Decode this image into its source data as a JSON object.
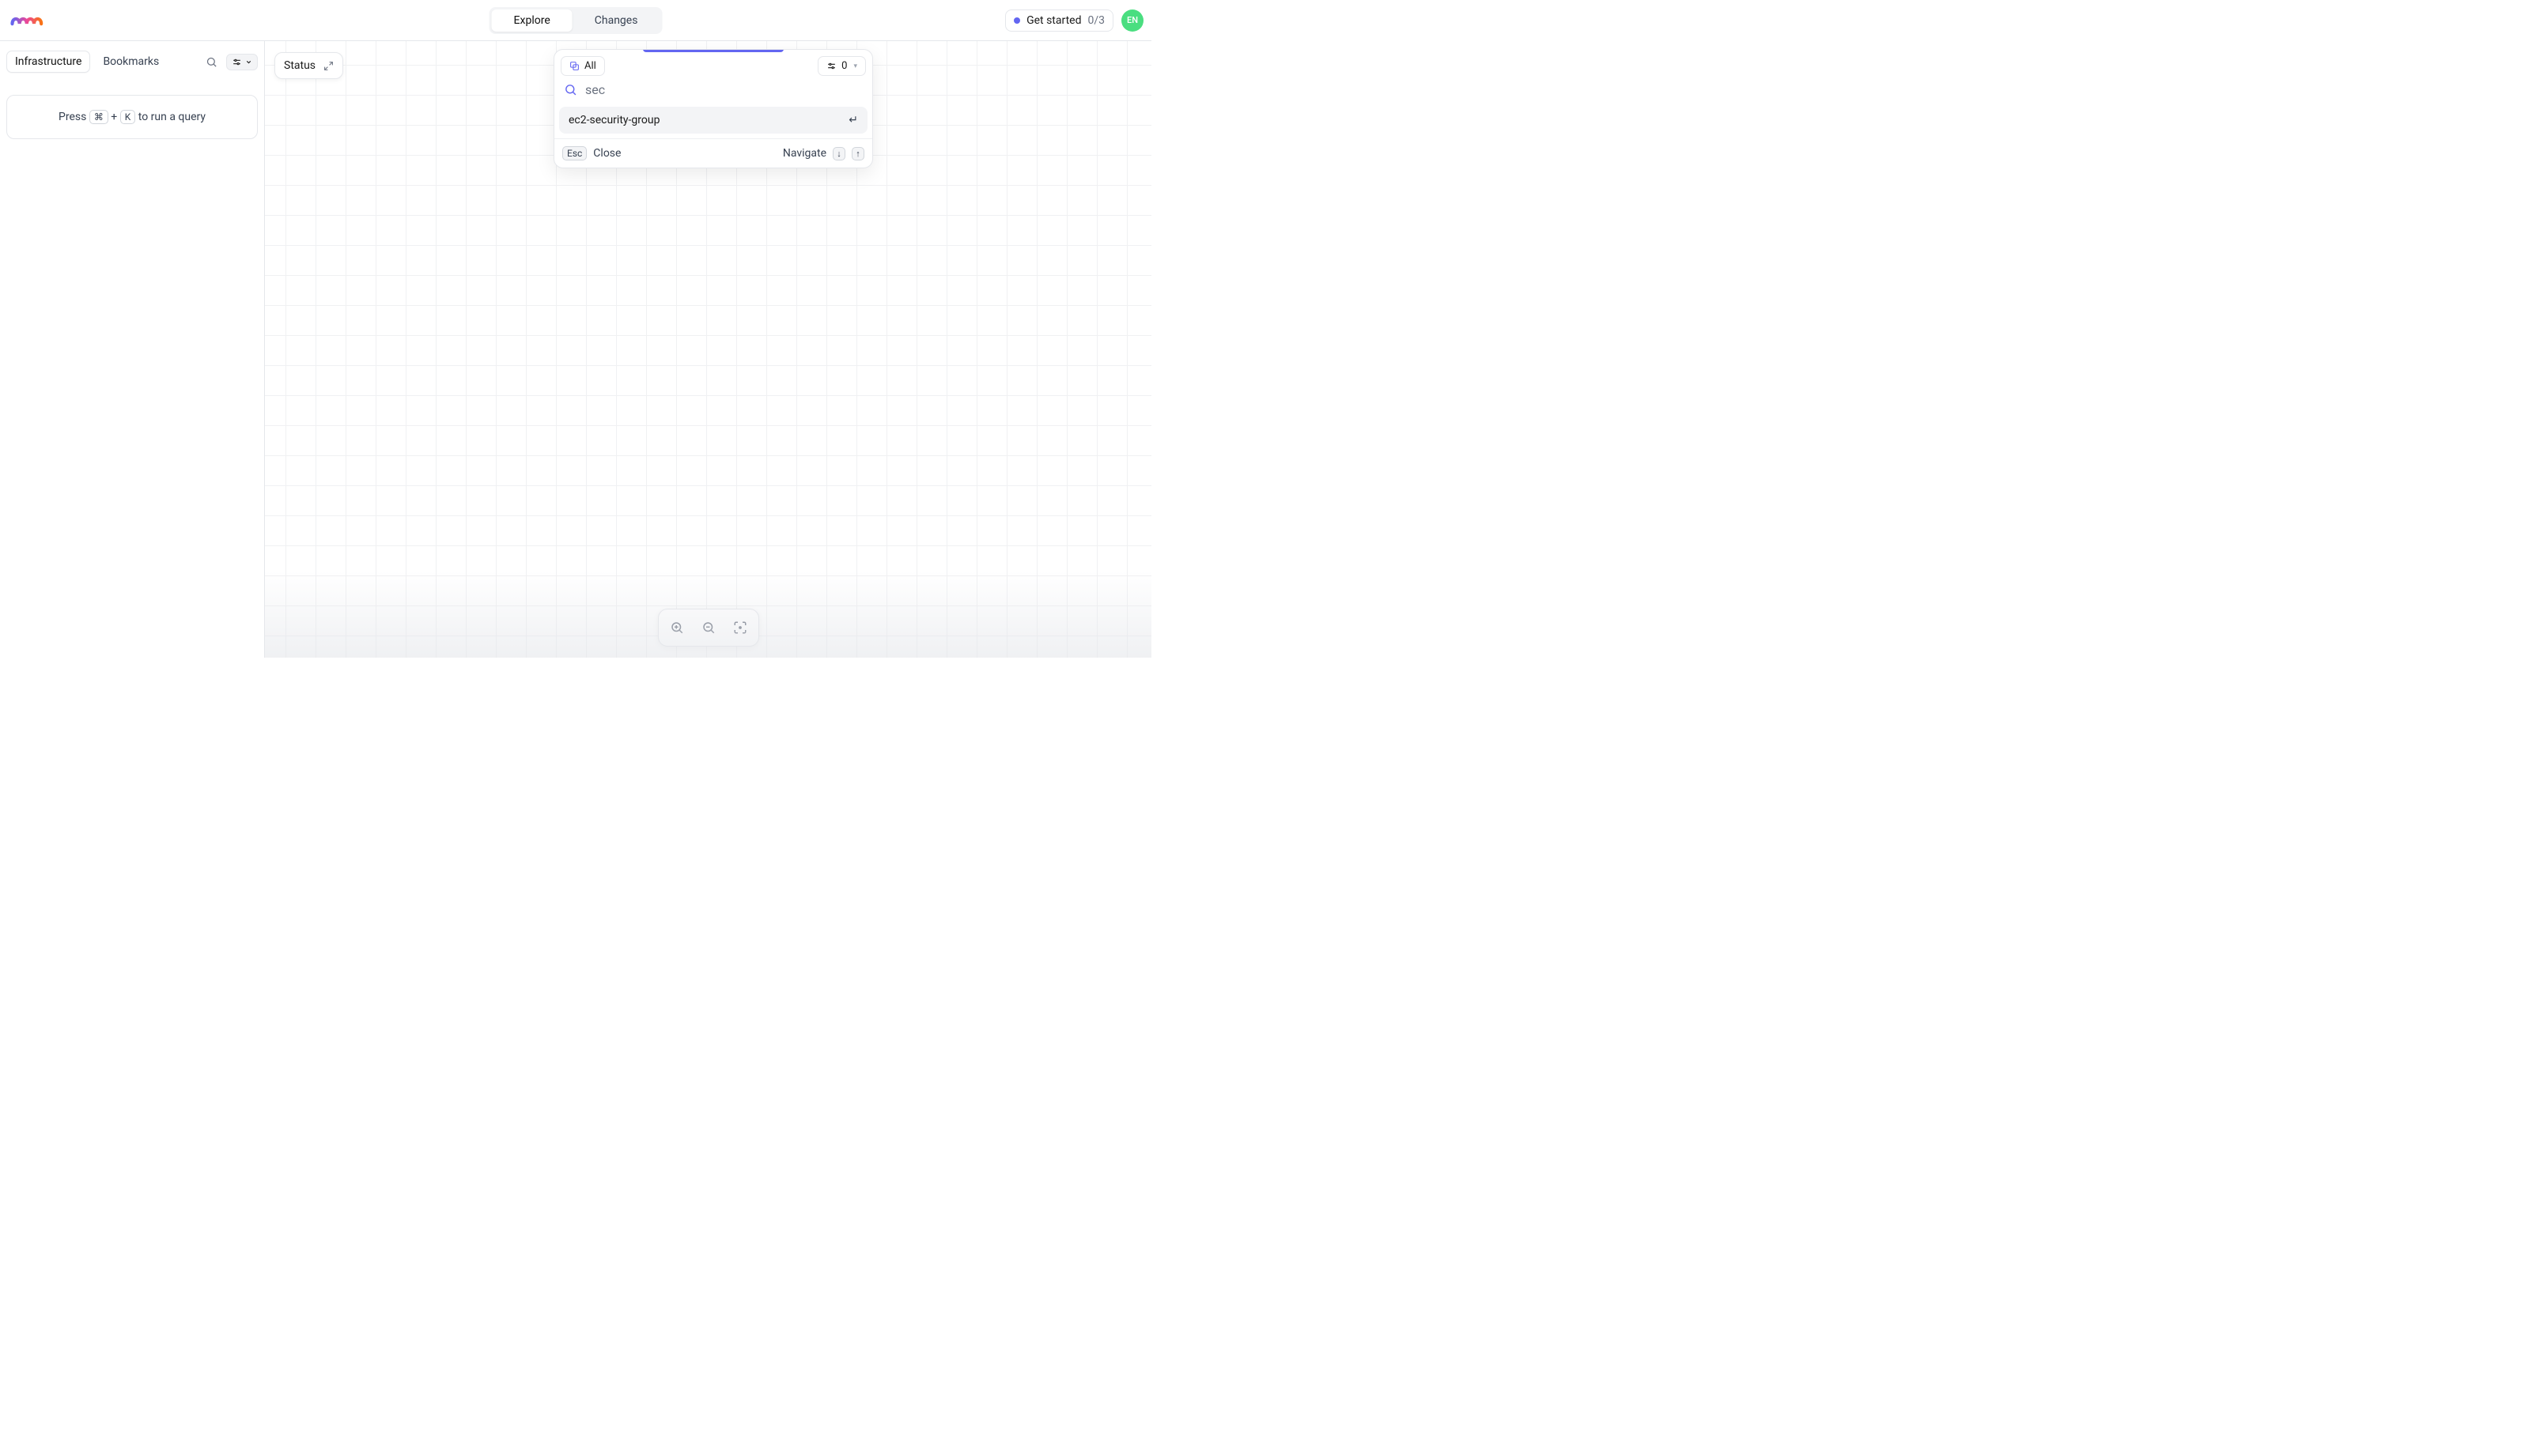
{
  "header": {
    "nav": {
      "explore": "Explore",
      "changes": "Changes"
    },
    "get_started": {
      "label": "Get started",
      "count": "0/3"
    },
    "avatar_initials": "EN"
  },
  "sidebar": {
    "tabs": {
      "infrastructure": "Infrastructure",
      "bookmarks": "Bookmarks"
    },
    "query_hint": {
      "prefix": "Press",
      "k1": "⌘",
      "plus": "+",
      "k2": "K",
      "suffix": "to run a query"
    }
  },
  "canvas": {
    "status_label": "Status"
  },
  "search": {
    "filter_all": "All",
    "filter_count": "0",
    "input_value": "sec",
    "result_0": "ec2-security-group",
    "footer": {
      "esc_key": "Esc",
      "close": "Close",
      "navigate": "Navigate",
      "down": "↓",
      "up": "↑"
    }
  }
}
